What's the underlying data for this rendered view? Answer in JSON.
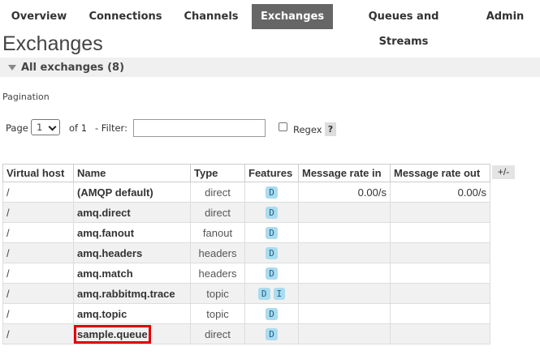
{
  "nav": {
    "tabs": [
      {
        "label": "Overview"
      },
      {
        "label": "Connections"
      },
      {
        "label": "Channels"
      },
      {
        "label": "Exchanges",
        "active": true
      },
      {
        "label": "Queues and Streams"
      },
      {
        "label": "Admin"
      }
    ]
  },
  "page": {
    "title": "Exchanges",
    "section_label": "All exchanges (8)"
  },
  "pagination": {
    "label": "Pagination",
    "page_label": "Page",
    "page_value": "1",
    "of_label": "of 1",
    "filter_label": "- Filter:",
    "filter_value": "",
    "regex_label": "Regex",
    "regex_checked": false,
    "help_label": "?"
  },
  "table": {
    "headers": [
      "Virtual host",
      "Name",
      "Type",
      "Features",
      "Message rate in",
      "Message rate out"
    ],
    "toggle_label": "+/-",
    "rows": [
      {
        "vhost": "/",
        "name": "(AMQP default)",
        "type": "direct",
        "features": [
          "D"
        ],
        "rate_in": "0.00/s",
        "rate_out": "0.00/s"
      },
      {
        "vhost": "/",
        "name": "amq.direct",
        "type": "direct",
        "features": [
          "D"
        ],
        "rate_in": "",
        "rate_out": ""
      },
      {
        "vhost": "/",
        "name": "amq.fanout",
        "type": "fanout",
        "features": [
          "D"
        ],
        "rate_in": "",
        "rate_out": ""
      },
      {
        "vhost": "/",
        "name": "amq.headers",
        "type": "headers",
        "features": [
          "D"
        ],
        "rate_in": "",
        "rate_out": ""
      },
      {
        "vhost": "/",
        "name": "amq.match",
        "type": "headers",
        "features": [
          "D"
        ],
        "rate_in": "",
        "rate_out": ""
      },
      {
        "vhost": "/",
        "name": "amq.rabbitmq.trace",
        "type": "topic",
        "features": [
          "D",
          "I"
        ],
        "rate_in": "",
        "rate_out": ""
      },
      {
        "vhost": "/",
        "name": "amq.topic",
        "type": "topic",
        "features": [
          "D"
        ],
        "rate_in": "",
        "rate_out": ""
      },
      {
        "vhost": "/",
        "name": "sample.queue",
        "type": "direct",
        "features": [
          "D"
        ],
        "rate_in": "",
        "rate_out": "",
        "highlighted": true
      }
    ]
  },
  "colors": {
    "active_tab_bg": "#666666",
    "badge_bg": "#aadcef",
    "highlight": "#e00000"
  }
}
